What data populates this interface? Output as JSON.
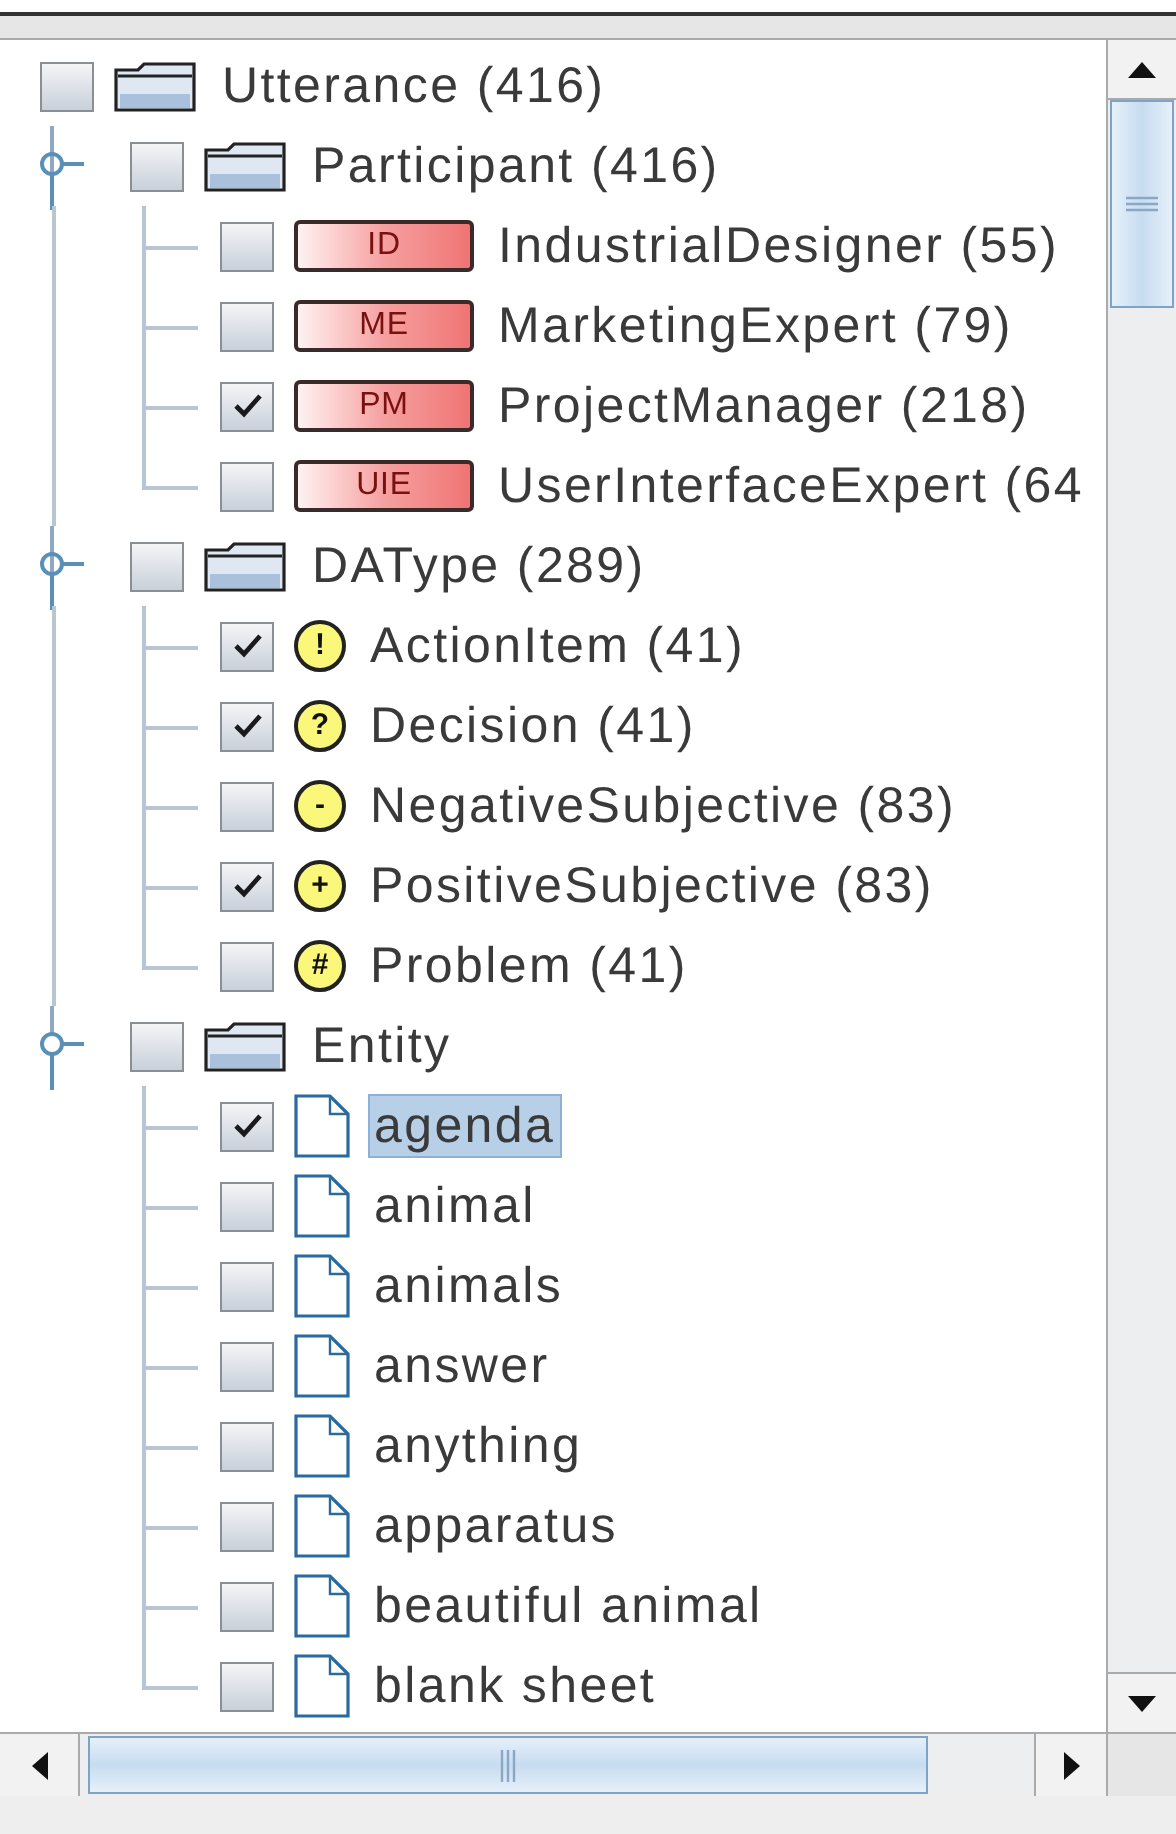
{
  "tree": {
    "label": "Utterance (416)",
    "kind": "folder",
    "checked": false,
    "selected": false,
    "children": [
      {
        "label": "Participant (416)",
        "kind": "folder",
        "checked": false,
        "selected": false,
        "expanded": true,
        "children": [
          {
            "label": "IndustrialDesigner (55)",
            "kind": "tag",
            "tag": "ID",
            "checked": false,
            "selected": false
          },
          {
            "label": "MarketingExpert (79)",
            "kind": "tag",
            "tag": "ME",
            "checked": false,
            "selected": false
          },
          {
            "label": "ProjectManager (218)",
            "kind": "tag",
            "tag": "PM",
            "checked": true,
            "selected": false
          },
          {
            "label": "UserInterfaceExpert (64",
            "kind": "tag",
            "tag": "UIE",
            "checked": false,
            "selected": false
          }
        ]
      },
      {
        "label": "DAType (289)",
        "kind": "folder",
        "checked": false,
        "selected": false,
        "expanded": true,
        "children": [
          {
            "label": "ActionItem (41)",
            "kind": "symbol",
            "symbol": "!",
            "checked": true,
            "selected": false
          },
          {
            "label": "Decision (41)",
            "kind": "symbol",
            "symbol": "?",
            "checked": true,
            "selected": false
          },
          {
            "label": "NegativeSubjective (83)",
            "kind": "symbol",
            "symbol": "-",
            "checked": false,
            "selected": false
          },
          {
            "label": "PositiveSubjective (83)",
            "kind": "symbol",
            "symbol": "+",
            "checked": true,
            "selected": false
          },
          {
            "label": "Problem (41)",
            "kind": "symbol",
            "symbol": "#",
            "checked": false,
            "selected": false
          }
        ]
      },
      {
        "label": "Entity",
        "kind": "folder",
        "checked": false,
        "selected": false,
        "expanded": true,
        "children": [
          {
            "label": "agenda",
            "kind": "document",
            "checked": true,
            "selected": true
          },
          {
            "label": "animal",
            "kind": "document",
            "checked": false,
            "selected": false
          },
          {
            "label": "animals",
            "kind": "document",
            "checked": false,
            "selected": false
          },
          {
            "label": "answer",
            "kind": "document",
            "checked": false,
            "selected": false
          },
          {
            "label": "anything",
            "kind": "document",
            "checked": false,
            "selected": false
          },
          {
            "label": "apparatus",
            "kind": "document",
            "checked": false,
            "selected": false
          },
          {
            "label": "beautiful animal",
            "kind": "document",
            "checked": false,
            "selected": false
          },
          {
            "label": "blank sheet",
            "kind": "document",
            "checked": false,
            "selected": false
          }
        ]
      }
    ]
  }
}
